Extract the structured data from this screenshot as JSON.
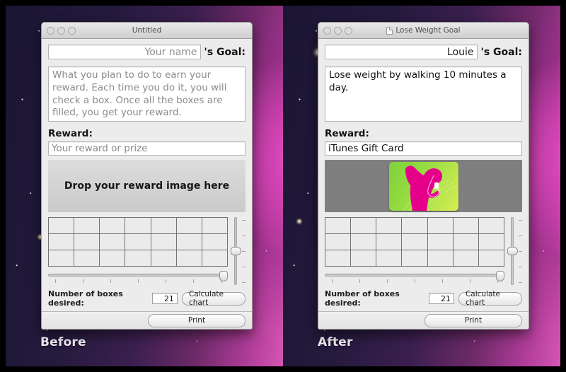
{
  "desktop": {
    "captions": [
      {
        "label": "Before"
      },
      {
        "label": "After"
      }
    ]
  },
  "windows": [
    {
      "id": "before",
      "title": "Untitled",
      "has_doc_icon": false,
      "name_field": {
        "value": "",
        "placeholder": "Your name"
      },
      "goal_suffix": "'s Goal:",
      "description": {
        "value": "",
        "placeholder": "What you plan to do to earn your reward.  Each time you do it, you will check a box.  Once all the boxes are filled, you get your reward."
      },
      "reward_label": "Reward:",
      "reward_field": {
        "value": "",
        "placeholder": "Your reward or prize"
      },
      "dropzone_label": "Drop your reward image here",
      "has_image": false,
      "image_alt": "",
      "boxes_label": "Number of boxes desired:",
      "boxes_value": "21",
      "calculate_label": "Calculate chart",
      "print_label": "Print"
    },
    {
      "id": "after",
      "title": "Lose Weight Goal",
      "has_doc_icon": true,
      "name_field": {
        "value": "Louie",
        "placeholder": "Your name"
      },
      "goal_suffix": "'s Goal:",
      "description": {
        "value": "Lose weight by walking 10 minutes a day.",
        "placeholder": "What you plan to do to earn your reward.  Each time you do it, you will check a box.  Once all the boxes are filled, you get your reward."
      },
      "reward_label": "Reward:",
      "reward_field": {
        "value": "iTunes Gift Card",
        "placeholder": "Your reward or prize"
      },
      "dropzone_label": "Drop your reward image here",
      "has_image": true,
      "image_alt": "itunes-gift-card-image",
      "boxes_label": "Number of boxes desired:",
      "boxes_value": "21",
      "calculate_label": "Calculate chart",
      "print_label": "Print"
    }
  ],
  "chart": {
    "columns": 7,
    "rows": 3,
    "total_cells": 21,
    "horizontal_slider_percent": 100,
    "vertical_slider_percent": 50,
    "horizontal_ticks": 7,
    "vertical_ticks": 5
  },
  "colors": {
    "window_chrome": "#ececec",
    "grid_line": "#737373",
    "grid_cell": "#ebebeb",
    "image_backdrop": "#7f7f7f",
    "card_green": "#8fd93e",
    "card_magenta": "#e5008c",
    "caption_text": "#f2eef7"
  }
}
